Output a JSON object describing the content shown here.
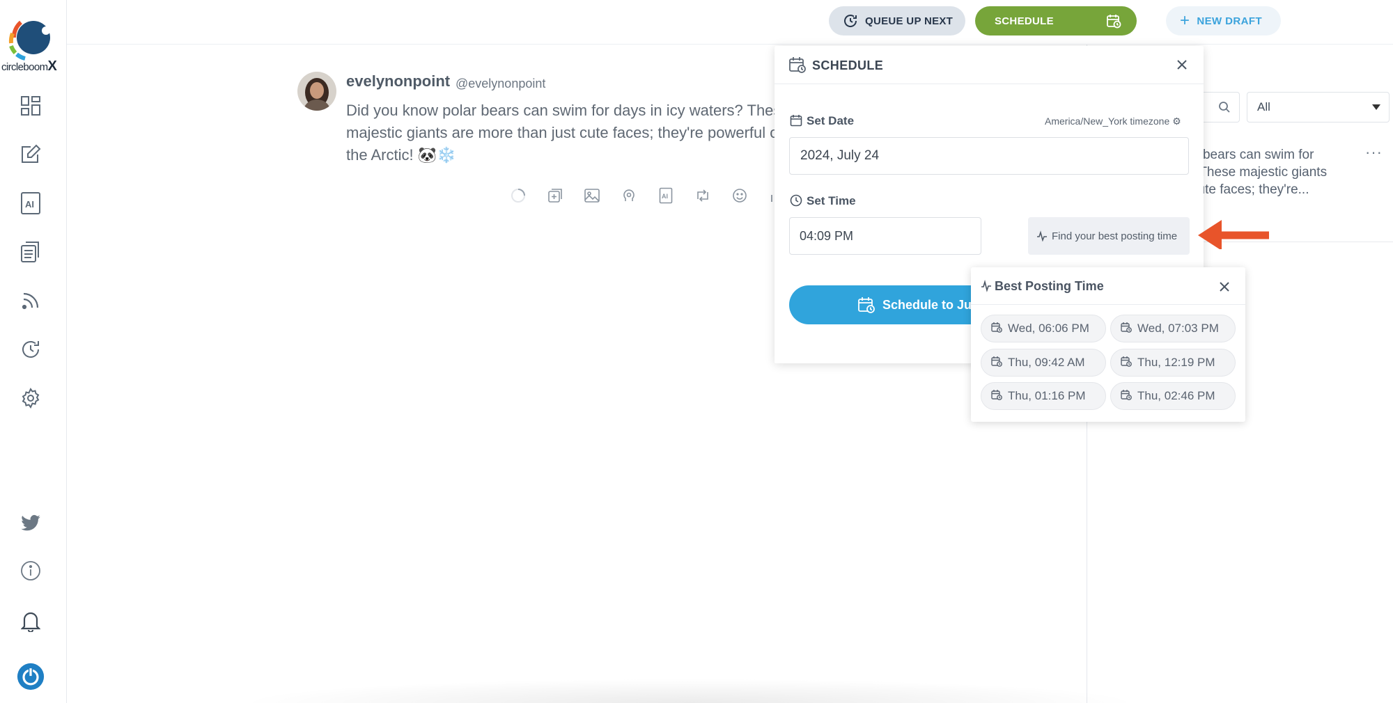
{
  "brand": {
    "logo_text": "circleboom",
    "logo_suffix": "X"
  },
  "topbar": {
    "queue_label": "QUEUE UP NEXT",
    "schedule_label": "SCHEDULE",
    "new_draft_label": "NEW DRAFT"
  },
  "tweet": {
    "name": "evelynonpoint",
    "handle": "@evelynonpoint",
    "text": "Did you know polar bears can swim for days in icy waters? These majestic giants are more than just cute faces; they're powerful of the Arctic! 🐼❄️"
  },
  "schedule_modal": {
    "title": "SCHEDULE",
    "set_date_label": "Set Date",
    "timezone": "America/New_York timezone",
    "date_value": "2024, July 24",
    "set_time_label": "Set Time",
    "time_value": "04:09 PM",
    "best_time_button": "Find your best posting time",
    "schedule_button": "Schedule to Ju"
  },
  "best_posting": {
    "title": "Best Posting Time",
    "slots": [
      "Wed, 06:06 PM",
      "Wed, 07:03 PM",
      "Thu, 09:42 AM",
      "Thu, 12:19 PM",
      "Thu, 01:16 PM",
      "Thu, 02:46 PM"
    ]
  },
  "right_panel": {
    "filter_value": "All",
    "preview_text": "olar bears can swim for\nrs? These majestic giants\nst cute faces; they're..."
  },
  "colors": {
    "schedule_green": "#77a53a",
    "primary_blue": "#30a4dc",
    "arrow_orange": "#e8542a",
    "logo_navy": "#1f4e79"
  }
}
